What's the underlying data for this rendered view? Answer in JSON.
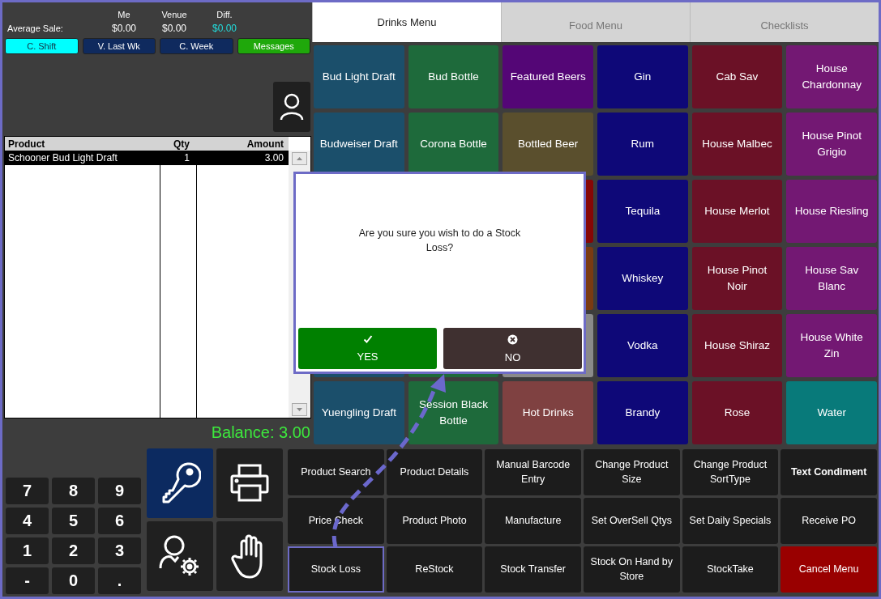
{
  "stats": {
    "row_label": "Average Sale:",
    "columns": [
      {
        "heading": "Me",
        "value": "$0.00",
        "kind": "plain"
      },
      {
        "heading": "Venue",
        "value": "$0.00",
        "kind": "plain"
      },
      {
        "heading": "Diff.",
        "value": "$0.00",
        "kind": "diff"
      }
    ]
  },
  "period_buttons": [
    {
      "label": "C. Shift",
      "selected": true
    },
    {
      "label": "V. Last Wk",
      "selected": false
    },
    {
      "label": "C. Week",
      "selected": false
    }
  ],
  "messages_button": {
    "label": "Messages"
  },
  "order_table": {
    "columns": [
      "Product",
      "Qty",
      "Amount"
    ],
    "rows": [
      {
        "product": "Schooner Bud Light Draft",
        "qty": "1",
        "amount": "3.00",
        "selected": true
      }
    ]
  },
  "balance": "Balance: 3.00",
  "tabs": [
    {
      "label": "Drinks Menu",
      "selected": true
    },
    {
      "label": "Food Menu",
      "selected": false
    },
    {
      "label": "Checklists",
      "selected": false
    }
  ],
  "menu_rows": [
    [
      {
        "label": "Bud Light Draft",
        "color": "#1b4f6b"
      },
      {
        "label": "Bud Bottle",
        "color": "#1e6a3b"
      },
      {
        "label": "Featured Beers",
        "color": "#540676"
      },
      {
        "label": "Gin",
        "color": "#0e0878"
      },
      {
        "label": "Cab Sav",
        "color": "#6b1126"
      },
      {
        "label": "House Chardonnay",
        "color": "#731873"
      }
    ],
    [
      {
        "label": "Budweiser Draft",
        "color": "#1b4f6b"
      },
      {
        "label": "Corona Bottle",
        "color": "#1e6a3b"
      },
      {
        "label": "Bottled Beer",
        "color": "#5a4f2d"
      },
      {
        "label": "Rum",
        "color": "#0e0878"
      },
      {
        "label": "House Malbec",
        "color": "#6b1126"
      },
      {
        "label": "House Pinot Grigio",
        "color": "#731873"
      }
    ],
    [
      null,
      null,
      {
        "color": "#860606"
      },
      {
        "label": "Tequila",
        "color": "#0e0878"
      },
      {
        "label": "House Merlot",
        "color": "#6b1126"
      },
      {
        "label": "House Riesling",
        "color": "#731873"
      }
    ],
    [
      null,
      null,
      {
        "color": "#7a3a12"
      },
      {
        "label": "Whiskey",
        "color": "#0e0878"
      },
      {
        "label": "House Pinot Noir",
        "color": "#6b1126"
      },
      {
        "label": "House Sav Blanc",
        "color": "#731873"
      }
    ],
    [
      {
        "color": "#1b4f6b"
      },
      {
        "color": "#1e6a3b"
      },
      {
        "color": "#8a8a8a"
      },
      {
        "label": "Vodka",
        "color": "#0e0878"
      },
      {
        "label": "House Shiraz",
        "color": "#6b1126"
      },
      {
        "label": "House White Zin",
        "color": "#731873"
      }
    ],
    [
      {
        "label": "Yuengling Draft",
        "color": "#1b4f6b"
      },
      {
        "label": "Session Black Bottle",
        "color": "#1e6a3b"
      },
      {
        "label": "Hot Drinks",
        "color": "#7f4141"
      },
      {
        "label": "Brandy",
        "color": "#0e0878"
      },
      {
        "label": "Rose",
        "color": "#6b1126"
      },
      {
        "label": "Water",
        "color": "#087a7a"
      }
    ]
  ],
  "dialog": {
    "message": "Are you sure you wish to do a Stock Loss?",
    "buttons": [
      {
        "label": "YES",
        "kind": "yes"
      },
      {
        "label": "NO",
        "kind": "no"
      }
    ]
  },
  "numpad": [
    "7",
    "8",
    "9",
    "4",
    "5",
    "6",
    "1",
    "2",
    "3",
    "-",
    "0",
    "."
  ],
  "tool_buttons": [
    {
      "kind": "key",
      "selected": true
    },
    {
      "kind": "printer",
      "selected": false
    },
    {
      "kind": "user-settings",
      "selected": false
    },
    {
      "kind": "hand",
      "selected": false
    }
  ],
  "function_buttons": [
    {
      "label": "Product Search",
      "kind": "normal",
      "highlighted": false
    },
    {
      "label": "Product Details",
      "kind": "normal",
      "highlighted": false
    },
    {
      "label": "Manual Barcode Entry",
      "kind": "normal",
      "highlighted": false
    },
    {
      "label": "Change Product Size",
      "kind": "normal",
      "highlighted": false
    },
    {
      "label": "Change Product SortType",
      "kind": "normal",
      "highlighted": false
    },
    {
      "label": "Text Condiment",
      "kind": "bold",
      "highlighted": false
    },
    {
      "label": "Price Check",
      "kind": "normal",
      "highlighted": false
    },
    {
      "label": "Product Photo",
      "kind": "normal",
      "highlighted": false
    },
    {
      "label": "Manufacture",
      "kind": "normal",
      "highlighted": false
    },
    {
      "label": "Set OverSell Qtys",
      "kind": "normal",
      "highlighted": false
    },
    {
      "label": "Set Daily Specials",
      "kind": "normal",
      "highlighted": false
    },
    {
      "label": "Receive PO",
      "kind": "normal",
      "highlighted": false
    },
    {
      "label": "Stock Loss",
      "kind": "normal",
      "highlighted": true
    },
    {
      "label": "ReStock",
      "kind": "normal",
      "highlighted": false
    },
    {
      "label": "Stock Transfer",
      "kind": "normal",
      "highlighted": false
    },
    {
      "label": "Stock On Hand by Store",
      "kind": "normal",
      "highlighted": false
    },
    {
      "label": "StockTake",
      "kind": "normal",
      "highlighted": false
    },
    {
      "label": "Cancel Menu",
      "kind": "cancel",
      "highlighted": false
    }
  ]
}
